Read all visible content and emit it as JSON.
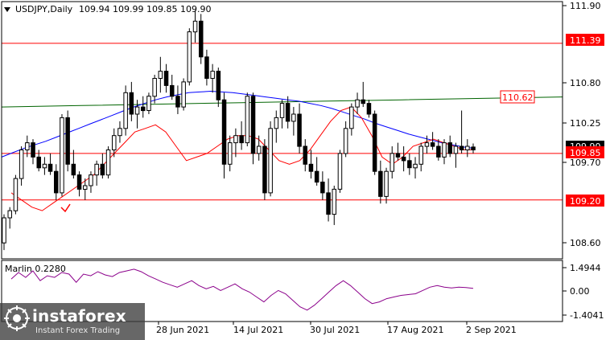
{
  "header": {
    "symbol": "USDJPY,Daily",
    "ohlc": "109.94 109.99 109.85 109.90"
  },
  "price_axis": {
    "ticks": [
      "111.90",
      "110.80",
      "110.25",
      "109.70",
      "108.60"
    ],
    "current_price": "109.90"
  },
  "levels": [
    {
      "label": "111.39",
      "price": 111.39,
      "color": "#ff0000"
    },
    {
      "label": "109.85",
      "price": 109.85,
      "color": "#ff0000"
    },
    {
      "label": "109.20",
      "price": 109.2,
      "color": "#ff0000"
    }
  ],
  "trendline_label": "110.62",
  "indicator": {
    "label": "Marlin 0.2280",
    "ticks": [
      "1.4944",
      "0.00",
      "-1.4041"
    ]
  },
  "time_axis": {
    "labels": [
      "28 Jun 2021",
      "14 Jul 2021",
      "30 Jul 2021",
      "17 Aug 2021",
      "2 Sep 2021"
    ]
  },
  "watermark": {
    "brand": "instaforex",
    "tagline": "Instant Forex Trading"
  },
  "colors": {
    "bull_candle": "#ffffff",
    "bear_candle": "#000000",
    "ma_blue": "#0000ff",
    "ma_green": "#006400",
    "envelope_red": "#ff0000",
    "level_red": "#ff0000",
    "oscillator": "#8b008b"
  },
  "chart_data": {
    "type": "candlestick",
    "ylim": [
      108.4,
      111.95
    ],
    "candles": [
      [
        108.6,
        109.0,
        108.5,
        108.95
      ],
      [
        108.95,
        109.1,
        108.8,
        109.05
      ],
      [
        109.05,
        109.55,
        109.0,
        109.5
      ],
      [
        109.5,
        109.95,
        109.4,
        109.9
      ],
      [
        109.9,
        110.1,
        109.8,
        110.0
      ],
      [
        110.0,
        110.05,
        109.7,
        109.8
      ],
      [
        109.8,
        109.9,
        109.6,
        109.65
      ],
      [
        109.65,
        109.8,
        109.55,
        109.7
      ],
      [
        109.7,
        109.85,
        109.55,
        109.6
      ],
      [
        109.6,
        109.7,
        109.2,
        109.3
      ],
      [
        109.3,
        110.4,
        109.25,
        110.35
      ],
      [
        110.35,
        110.45,
        109.6,
        109.7
      ],
      [
        109.7,
        109.9,
        109.5,
        109.55
      ],
      [
        109.55,
        109.6,
        109.25,
        109.35
      ],
      [
        109.35,
        109.5,
        109.2,
        109.4
      ],
      [
        109.4,
        109.6,
        109.3,
        109.55
      ],
      [
        109.55,
        109.75,
        109.4,
        109.7
      ],
      [
        109.7,
        109.85,
        109.5,
        109.55
      ],
      [
        109.55,
        109.95,
        109.5,
        109.9
      ],
      [
        109.9,
        110.2,
        109.8,
        110.1
      ],
      [
        110.1,
        110.3,
        110.0,
        110.2
      ],
      [
        110.2,
        110.8,
        110.1,
        110.7
      ],
      [
        110.7,
        110.85,
        110.3,
        110.4
      ],
      [
        110.4,
        110.6,
        110.2,
        110.5
      ],
      [
        110.5,
        110.65,
        110.35,
        110.45
      ],
      [
        110.45,
        110.7,
        110.4,
        110.65
      ],
      [
        110.65,
        110.95,
        110.55,
        110.9
      ],
      [
        110.9,
        111.2,
        110.7,
        111.0
      ],
      [
        111.0,
        111.1,
        110.7,
        110.8
      ],
      [
        110.8,
        110.95,
        110.6,
        110.65
      ],
      [
        110.65,
        110.8,
        110.4,
        110.5
      ],
      [
        110.5,
        110.9,
        110.45,
        110.85
      ],
      [
        110.85,
        111.6,
        110.8,
        111.55
      ],
      [
        111.55,
        111.85,
        111.4,
        111.7
      ],
      [
        111.7,
        111.8,
        111.1,
        111.2
      ],
      [
        111.2,
        111.3,
        110.8,
        110.9
      ],
      [
        110.9,
        111.1,
        110.7,
        111.0
      ],
      [
        111.0,
        111.05,
        110.5,
        110.6
      ],
      [
        110.6,
        110.7,
        109.5,
        109.7
      ],
      [
        109.7,
        110.1,
        109.6,
        110.0
      ],
      [
        110.0,
        110.2,
        109.8,
        110.1
      ],
      [
        110.1,
        110.3,
        109.9,
        110.0
      ],
      [
        110.0,
        110.7,
        109.95,
        110.65
      ],
      [
        110.65,
        110.7,
        109.7,
        109.85
      ],
      [
        109.85,
        110.1,
        109.75,
        109.95
      ],
      [
        109.95,
        110.05,
        109.2,
        109.3
      ],
      [
        109.3,
        110.3,
        109.25,
        110.2
      ],
      [
        110.2,
        110.45,
        110.0,
        110.35
      ],
      [
        110.35,
        110.6,
        110.2,
        110.55
      ],
      [
        110.55,
        110.65,
        110.2,
        110.3
      ],
      [
        110.3,
        110.5,
        110.1,
        110.4
      ],
      [
        110.4,
        110.55,
        109.85,
        109.95
      ],
      [
        109.95,
        110.05,
        109.6,
        109.7
      ],
      [
        109.7,
        109.9,
        109.5,
        109.6
      ],
      [
        109.6,
        109.8,
        109.4,
        109.45
      ],
      [
        109.45,
        109.6,
        109.2,
        109.3
      ],
      [
        109.3,
        109.5,
        108.9,
        109.0
      ],
      [
        109.0,
        109.4,
        108.85,
        109.35
      ],
      [
        109.35,
        109.9,
        109.3,
        109.85
      ],
      [
        109.85,
        110.3,
        109.8,
        110.2
      ],
      [
        110.2,
        110.55,
        110.1,
        110.5
      ],
      [
        110.5,
        110.7,
        110.4,
        110.6
      ],
      [
        110.6,
        110.85,
        110.5,
        110.55
      ],
      [
        110.55,
        110.6,
        110.35,
        110.4
      ],
      [
        110.4,
        110.45,
        109.55,
        109.6
      ],
      [
        109.6,
        109.75,
        109.15,
        109.25
      ],
      [
        109.25,
        109.65,
        109.15,
        109.6
      ],
      [
        109.6,
        109.95,
        109.5,
        109.85
      ],
      [
        109.85,
        110.0,
        109.75,
        109.8
      ],
      [
        109.8,
        109.95,
        109.6,
        109.75
      ],
      [
        109.75,
        109.85,
        109.55,
        109.65
      ],
      [
        109.65,
        109.8,
        109.5,
        109.7
      ],
      [
        109.7,
        110.0,
        109.6,
        109.95
      ],
      [
        109.95,
        110.1,
        109.85,
        110.0
      ],
      [
        110.0,
        110.15,
        109.9,
        109.95
      ],
      [
        109.95,
        110.05,
        109.75,
        109.8
      ],
      [
        109.8,
        110.05,
        109.7,
        110.0
      ],
      [
        110.0,
        110.1,
        109.8,
        109.85
      ],
      [
        109.85,
        110.0,
        109.65,
        109.95
      ],
      [
        109.95,
        110.45,
        109.85,
        109.9
      ],
      [
        109.9,
        110.05,
        109.8,
        109.95
      ],
      [
        109.94,
        109.99,
        109.85,
        109.9
      ]
    ],
    "ma_blue": [
      109.8,
      109.86,
      109.92,
      109.97,
      110.02,
      110.08,
      110.14,
      110.2,
      110.26,
      110.32,
      110.38,
      110.44,
      110.5,
      110.55,
      110.6,
      110.64,
      110.67,
      110.7,
      110.71,
      110.72,
      110.71,
      110.7,
      110.68,
      110.66,
      110.64,
      110.62,
      110.6,
      110.58,
      110.55,
      110.52,
      110.48,
      110.43,
      110.38,
      110.33,
      110.27,
      110.22,
      110.17,
      110.12,
      110.08,
      110.04,
      110.0,
      109.97,
      109.94,
      109.92
    ],
    "ma_green": [
      110.5,
      110.52,
      110.54,
      110.56,
      110.58,
      110.6,
      110.62,
      110.64
    ],
    "envelope_red": [
      109.3,
      109.2,
      109.1,
      109.05,
      109.15,
      109.25,
      109.35,
      109.45,
      109.55,
      109.7,
      109.85,
      110.0,
      110.15,
      110.2,
      110.25,
      110.15,
      109.95,
      109.75,
      109.8,
      109.85,
      109.95,
      110.05,
      110.1,
      110.1,
      110.05,
      109.9,
      109.75,
      109.7,
      109.75,
      109.9,
      110.1,
      110.3,
      110.45,
      110.5,
      110.35,
      110.1,
      109.8,
      109.7,
      109.8,
      109.95,
      110.0,
      110.05,
      110.0,
      109.95,
      109.9,
      109.9
    ],
    "oscillator": [
      0.8,
      1.2,
      0.9,
      1.3,
      0.7,
      1.0,
      0.9,
      1.2,
      1.1,
      0.6,
      1.1,
      1.0,
      1.25,
      1.05,
      0.95,
      1.2,
      1.3,
      1.4,
      1.25,
      1.0,
      0.8,
      0.6,
      0.45,
      0.3,
      0.5,
      0.7,
      0.4,
      0.2,
      0.35,
      0.1,
      0.3,
      0.5,
      0.2,
      0.0,
      -0.3,
      -0.6,
      -0.2,
      0.1,
      -0.1,
      -0.5,
      -0.9,
      -1.1,
      -0.8,
      -0.4,
      0.0,
      0.4,
      0.7,
      0.4,
      0.0,
      -0.4,
      -0.7,
      -0.6,
      -0.4,
      -0.3,
      -0.2,
      -0.15,
      -0.1,
      0.1,
      0.3,
      0.4,
      0.3,
      0.25,
      0.3,
      0.28,
      0.23
    ]
  }
}
